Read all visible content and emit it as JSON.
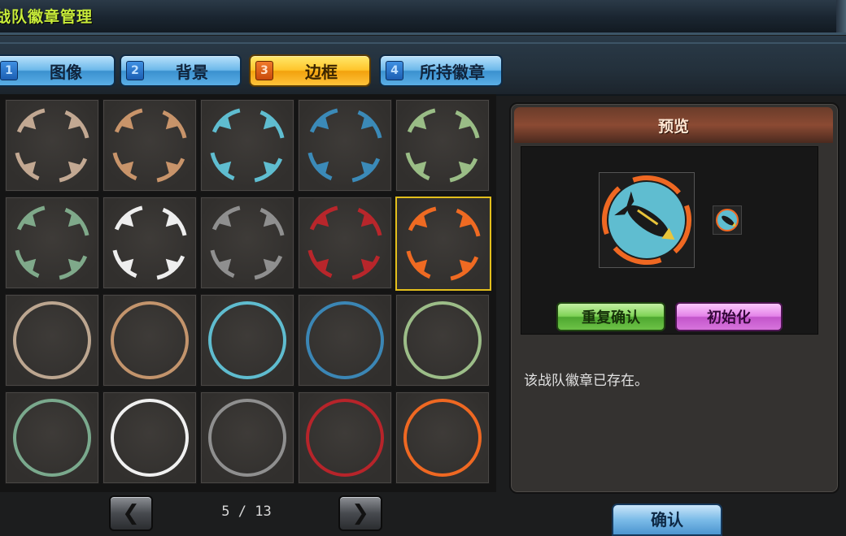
{
  "window": {
    "title": "战队徽章管理"
  },
  "tabs": [
    {
      "num": "1",
      "label": "图像",
      "active": false
    },
    {
      "num": "2",
      "label": "背景",
      "active": false
    },
    {
      "num": "3",
      "label": "边框",
      "active": true
    },
    {
      "num": "4",
      "label": "所持徽章",
      "active": false
    }
  ],
  "frames": {
    "arrow_colors": [
      "#c2a892",
      "#c8946a",
      "#5fbdd0",
      "#3b8ab8",
      "#9abd86",
      "#7fa98a",
      "#eeeeee",
      "#8f8f8f",
      "#b8262b",
      "#ef6a22"
    ],
    "ring_colors": [
      "#bca690",
      "#c3946c",
      "#5fbccf",
      "#3b86b5",
      "#9cbd88",
      "#7aa98d",
      "#f0f0f0",
      "#8f8f8f",
      "#b7242a",
      "#ef6822"
    ],
    "selected_index": 9
  },
  "pager": {
    "prev_icon": "chevron-left-icon",
    "next_icon": "chevron-right-icon",
    "current": "5",
    "total": "13",
    "text": "5 / 13"
  },
  "preview": {
    "title": "预览",
    "reconfirm_label": "重复确认",
    "reset_label": "初始化",
    "status_text": "该战队徽章已存在。",
    "badge": {
      "icon": "missile-icon",
      "background_color": "#5fbdd0",
      "frame_color": "#ef6822"
    }
  },
  "confirm_label": "确认"
}
